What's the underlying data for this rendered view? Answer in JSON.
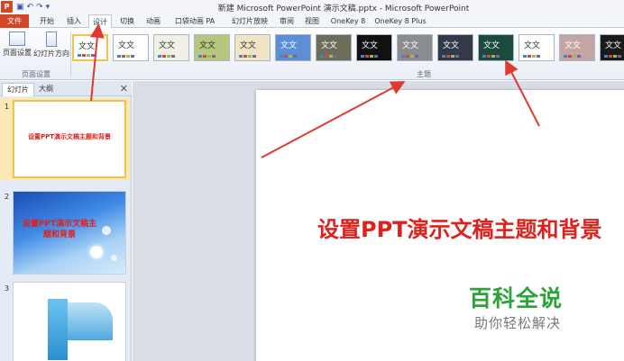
{
  "titlebar": {
    "app_icon": "P",
    "window_title": "新建 Microsoft PowerPoint 演示文稿.pptx - Microsoft PowerPoint",
    "qat_icons": [
      "save-icon",
      "undo-icon",
      "redo-icon",
      "customize-icon"
    ]
  },
  "tabs": [
    "文件",
    "开始",
    "插入",
    "设计",
    "切换",
    "动画",
    "口袋动画 PA",
    "幻灯片放映",
    "审阅",
    "视图",
    "OneKey 8",
    "OneKey 8 Plus"
  ],
  "active_tab": "设计",
  "ribbon": {
    "page_setup_label": "页面设置",
    "slide_orientation_label": "幻灯片方向",
    "group_page_setup": "页面设置",
    "group_themes": "主题",
    "theme_sample_text": "文文"
  },
  "themes": [
    {
      "bg": "#ffffff",
      "fg": "#333333"
    },
    {
      "bg": "#ffffff",
      "fg": "#333333"
    },
    {
      "bg": "#f2efe4",
      "fg": "#333333"
    },
    {
      "bg": "#b7c77e",
      "fg": "#333333"
    },
    {
      "bg": "#efe4c4",
      "fg": "#333333"
    },
    {
      "bg": "#5c8fd6",
      "fg": "#ffffff"
    },
    {
      "bg": "#6d6e59",
      "fg": "#ffffff"
    },
    {
      "bg": "#111111",
      "fg": "#ffffff"
    },
    {
      "bg": "#8a8c8e",
      "fg": "#ffffff"
    },
    {
      "bg": "#323a4a",
      "fg": "#ffffff"
    },
    {
      "bg": "#1d4a3f",
      "fg": "#ffffff"
    },
    {
      "bg": "#ffffff",
      "fg": "#333333"
    },
    {
      "bg": "#c5a4a4",
      "fg": "#ffffff"
    },
    {
      "bg": "#1a1a1a",
      "fg": "#ffffff"
    }
  ],
  "panel": {
    "tab_slides": "幻灯片",
    "tab_outline": "大纲",
    "close": "✕",
    "slides": [
      {
        "number": "1",
        "title": "设置PPT演示文稿主题和背景"
      },
      {
        "number": "2",
        "title": "设置PPT演示文稿主题和背景"
      },
      {
        "number": "3",
        "title": ""
      }
    ]
  },
  "slide": {
    "title": "设置PPT演示文稿主题和背景"
  },
  "watermark": {
    "main": "百科全说",
    "sub": "助你轻松解决"
  },
  "colors": {
    "accent_red": "#e0201b",
    "file_tab": "#d24726",
    "selection": "#f2c14e",
    "watermark_green": "#2aa33a"
  }
}
